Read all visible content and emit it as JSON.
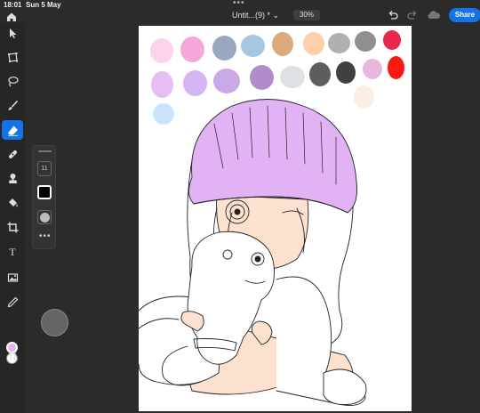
{
  "status": {
    "time": "18:01",
    "date": "Sun 5 May",
    "dots": "•••"
  },
  "topbar": {
    "title": "Untit...(9) *",
    "title_chevron": "⌄",
    "zoom": "30%",
    "share_label": "Share",
    "icons": [
      "home-icon",
      "undo-icon",
      "redo-icon",
      "cloud-icon"
    ]
  },
  "toolbar": {
    "tools": [
      {
        "name": "select-tool",
        "icon": "arrow-icon"
      },
      {
        "name": "transform-tool",
        "icon": "transform-icon"
      },
      {
        "name": "lasso-tool",
        "icon": "lasso-icon"
      },
      {
        "name": "brush-tool",
        "icon": "brush-icon"
      },
      {
        "name": "eraser-tool",
        "icon": "eraser-icon",
        "active": true
      },
      {
        "name": "healing-tool",
        "icon": "bandage-icon"
      },
      {
        "name": "clone-tool",
        "icon": "stamp-icon"
      },
      {
        "name": "fill-tool",
        "icon": "paint-bucket-icon"
      },
      {
        "name": "crop-tool",
        "icon": "crop-icon"
      },
      {
        "name": "type-tool",
        "icon": "type-icon",
        "text": "T"
      },
      {
        "name": "image-tool",
        "icon": "image-icon"
      },
      {
        "name": "eyedropper-tool",
        "icon": "eyedropper-icon"
      },
      {
        "name": "swap-colors-tool",
        "icon": "swap-icon"
      }
    ],
    "foreground_color": "#e4b3f3",
    "background_color": "#ffffff"
  },
  "brush_panel": {
    "size": "11",
    "colors": [
      "#000000",
      "#bbbbbb"
    ]
  },
  "palette": [
    "#fcd3ea",
    "#f5a7d8",
    "#99a7c0",
    "#a7c6e0",
    "#ddaa80",
    "#fdd0a9",
    "#b1b0b1",
    "#8f8f8f",
    "#e9274c",
    "#e7bdf5",
    "#d4b6f3",
    "#c9aae6",
    "#b28bcf",
    "#dde1e4",
    "#5d5d5d",
    "#404040",
    "#e8b7de",
    "#f51a12",
    "#fdeee5",
    "#cbe3fb",
    "#d29ef2"
  ],
  "colors": {
    "accent": "#1473e6",
    "app_bg": "#2b2b2b",
    "toolbar_bg": "#262626",
    "hat": "#e1b3f5",
    "skin": "#fde1cf"
  }
}
